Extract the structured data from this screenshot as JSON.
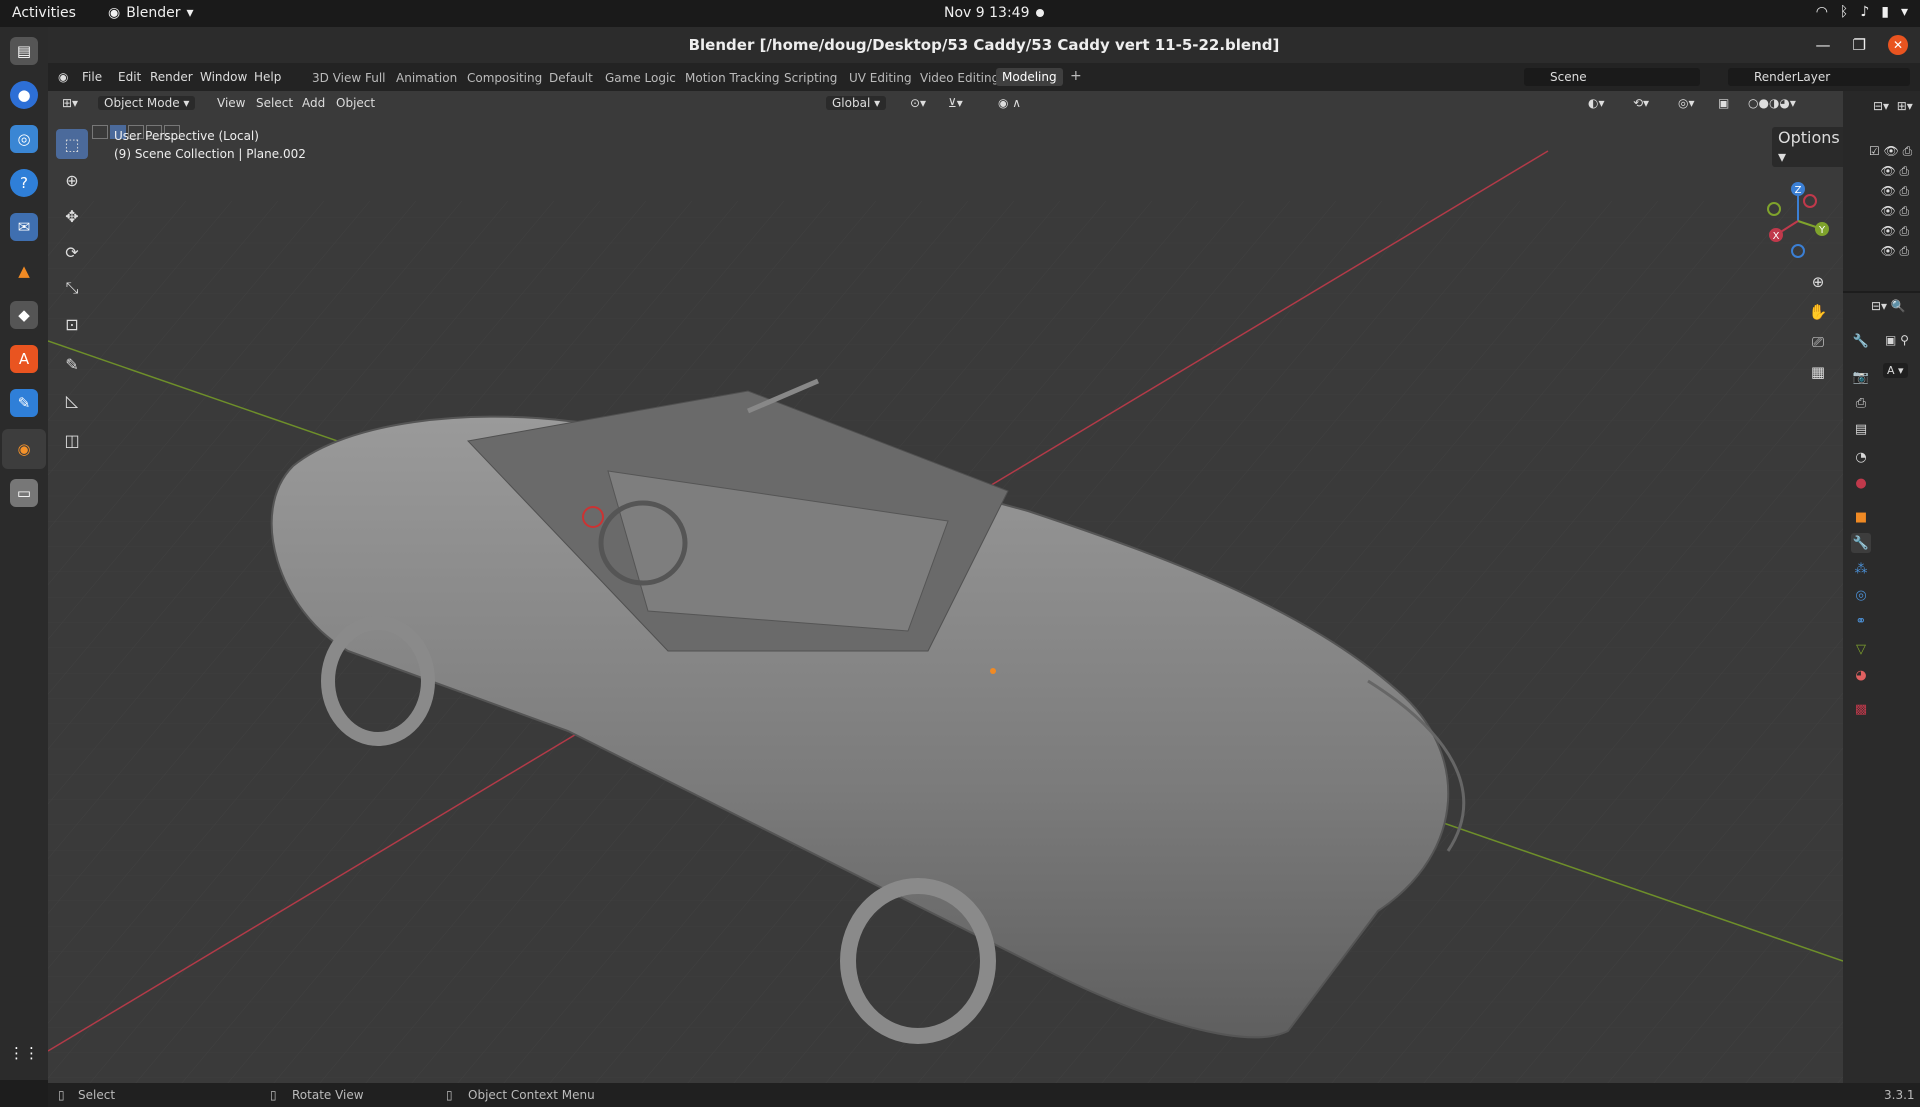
{
  "os": {
    "activities": "Activities",
    "app_name": "Blender",
    "clock": "Nov 9  13:49"
  },
  "window": {
    "title": "Blender [/home/doug/Desktop/53 Caddy/53 Caddy vert 11-5-22.blend]"
  },
  "menu": [
    "File",
    "Edit",
    "Render",
    "Window",
    "Help"
  ],
  "workspaces": [
    "3D View Full",
    "Animation",
    "Compositing",
    "Default",
    "Game Logic",
    "Motion Tracking",
    "Scripting",
    "UV Editing",
    "Video Editing",
    "Modeling"
  ],
  "active_workspace": "Modeling",
  "scene": "Scene",
  "view_layer": "RenderLayer",
  "viewport_header": {
    "mode": "Object Mode",
    "items": [
      "View",
      "Select",
      "Add",
      "Object"
    ],
    "transform_orientation": "Global",
    "options": "Options"
  },
  "viewport": {
    "perspective_label": "User Perspective (Local)",
    "collection_label": "(9) Scene Collection | Plane.002",
    "gizmo_axes": [
      "Z",
      "Y",
      "X"
    ]
  },
  "status_bar": {
    "select": "Select",
    "rotate": "Rotate View",
    "context_menu": "Object Context Menu",
    "version": "3.3.1"
  },
  "colors": {
    "accent": "#4b6a9b",
    "x_axis": "#c0394b",
    "y_axis": "#7fa32c",
    "z_axis": "#3b7fd4",
    "ubuntu_orange": "#e95420"
  }
}
